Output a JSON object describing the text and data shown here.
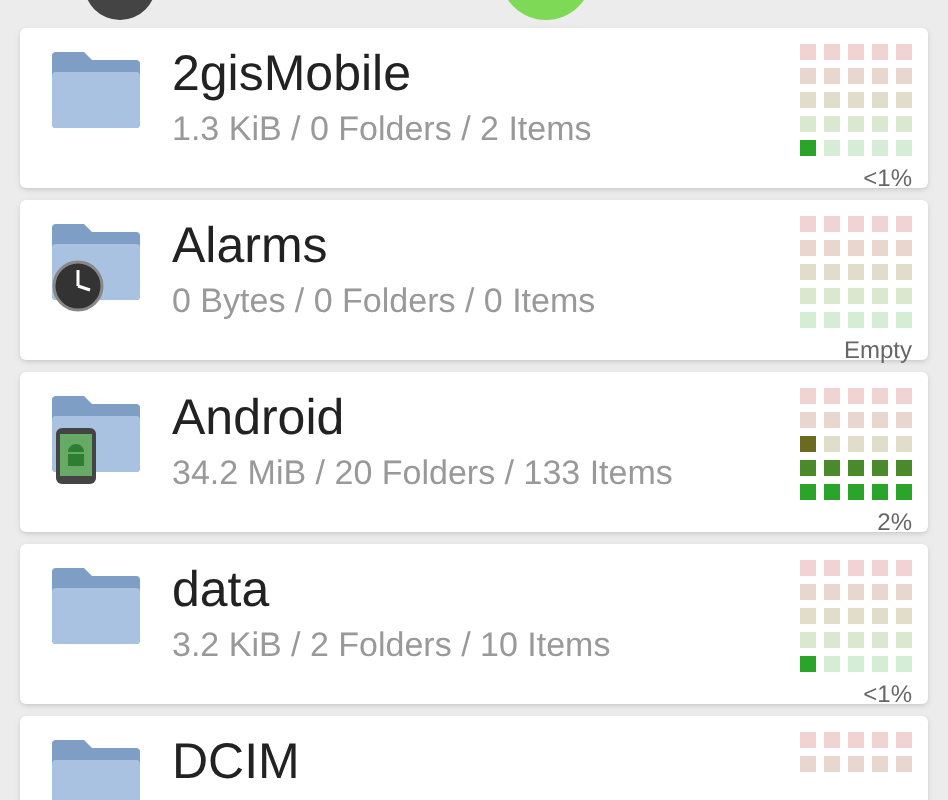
{
  "folders": [
    {
      "name": "2gisMobile",
      "details": "1.3 KiB / 0 Folders / 2 Items",
      "kind": "plain",
      "meter": [
        [
          false,
          false,
          false,
          false,
          false
        ],
        [
          false,
          false,
          false,
          false,
          false
        ],
        [
          false,
          false,
          false,
          false,
          false
        ],
        [
          false,
          false,
          false,
          false,
          false
        ],
        [
          true,
          false,
          false,
          false,
          false
        ]
      ],
      "percent": "<1%"
    },
    {
      "name": "Alarms",
      "details": "0 Bytes / 0 Folders / 0 Items",
      "kind": "clock",
      "meter": [
        [
          false,
          false,
          false,
          false,
          false
        ],
        [
          false,
          false,
          false,
          false,
          false
        ],
        [
          false,
          false,
          false,
          false,
          false
        ],
        [
          false,
          false,
          false,
          false,
          false
        ],
        [
          false,
          false,
          false,
          false,
          false
        ]
      ],
      "percent": "Empty"
    },
    {
      "name": "Android",
      "details": "34.2 MiB / 20 Folders / 133 Items",
      "kind": "android",
      "meter": [
        [
          false,
          false,
          false,
          false,
          false
        ],
        [
          false,
          false,
          false,
          false,
          false
        ],
        [
          true,
          false,
          false,
          false,
          false
        ],
        [
          true,
          true,
          true,
          true,
          true
        ],
        [
          true,
          true,
          true,
          true,
          true
        ]
      ],
      "percent": "2%"
    },
    {
      "name": "data",
      "details": "3.2 KiB / 2 Folders / 10 Items",
      "kind": "plain",
      "meter": [
        [
          false,
          false,
          false,
          false,
          false
        ],
        [
          false,
          false,
          false,
          false,
          false
        ],
        [
          false,
          false,
          false,
          false,
          false
        ],
        [
          false,
          false,
          false,
          false,
          false
        ],
        [
          true,
          false,
          false,
          false,
          false
        ]
      ],
      "percent": "<1%"
    },
    {
      "name": "DCIM",
      "kind": "plain",
      "meter": [
        [
          false,
          false,
          false,
          false,
          false
        ],
        [
          false,
          false,
          false,
          false,
          false
        ]
      ]
    }
  ]
}
